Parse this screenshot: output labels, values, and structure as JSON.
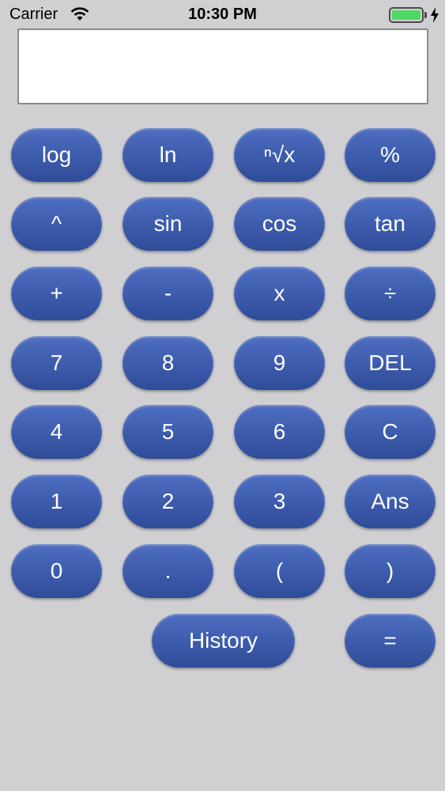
{
  "status_bar": {
    "carrier": "Carrier",
    "time": "10:30 PM",
    "battery_level": 1.0,
    "battery_color": "#4cd964"
  },
  "display": {
    "value": ""
  },
  "colors": {
    "background": "#d0cfd2",
    "key": "#3f5eb0",
    "key_text": "#ffffff"
  },
  "keys": {
    "log": "log",
    "ln": "ln",
    "nth_root": "ⁿ√x",
    "percent": "%",
    "power": "^",
    "sin": "sin",
    "cos": "cos",
    "tan": "tan",
    "plus": "+",
    "minus": "-",
    "multiply": "x",
    "divide": "÷",
    "seven": "7",
    "eight": "8",
    "nine": "9",
    "delete": "DEL",
    "four": "4",
    "five": "5",
    "six": "6",
    "clear": "C",
    "one": "1",
    "two": "2",
    "three": "3",
    "ans": "Ans",
    "zero": "0",
    "decimal": ".",
    "open_paren": "(",
    "close_paren": ")",
    "history": "History",
    "equals": "="
  }
}
